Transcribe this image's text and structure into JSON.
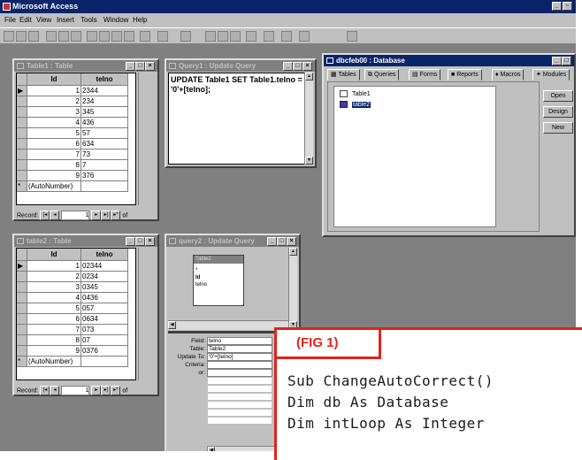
{
  "app": {
    "title": "Microsoft Access"
  },
  "menu": [
    "File",
    "Edit",
    "View",
    "Insert",
    "Tools",
    "Window",
    "Help"
  ],
  "table1": {
    "title": "Table1 : Table",
    "columns": [
      "Id",
      "telno"
    ],
    "rows": [
      [
        "1",
        "2344"
      ],
      [
        "2",
        "234"
      ],
      [
        "3",
        "345"
      ],
      [
        "4",
        "436"
      ],
      [
        "5",
        "57"
      ],
      [
        "6",
        "634"
      ],
      [
        "7",
        "73"
      ],
      [
        "8",
        "7"
      ],
      [
        "9",
        "376"
      ]
    ],
    "new_row": "(AutoNumber)",
    "record_label": "Record:",
    "record_value": "1",
    "of_label": "of"
  },
  "query1": {
    "title": "Query1 : Update Query",
    "sql": "UPDATE Table1 SET Table1.telno = '0'+[telno];"
  },
  "database": {
    "title": "dbcfeb00 : Database",
    "tabs": [
      "Tables",
      "Queries",
      "Forms",
      "Reports",
      "Macros",
      "Modules"
    ],
    "items": [
      "Table1",
      "table2"
    ],
    "buttons": [
      "Open",
      "Design",
      "New"
    ]
  },
  "table2": {
    "title": "table2 : Table",
    "columns": [
      "Id",
      "telno"
    ],
    "rows": [
      [
        "1",
        "02344"
      ],
      [
        "2",
        "0234"
      ],
      [
        "3",
        "0345"
      ],
      [
        "4",
        "0436"
      ],
      [
        "5",
        "057"
      ],
      [
        "6",
        "0634"
      ],
      [
        "7",
        "073"
      ],
      [
        "8",
        "07"
      ],
      [
        "9",
        "0376"
      ]
    ],
    "new_row": "(AutoNumber)",
    "record_label": "Record:",
    "record_value": "1",
    "of_label": "of"
  },
  "query2": {
    "title": "query2 : Update Query",
    "table_box": {
      "name": "Table2",
      "fields": [
        "*",
        "Id",
        "telno"
      ]
    },
    "grid": {
      "labels": [
        "Field:",
        "Table:",
        "Update To:",
        "Criteria:",
        "or:"
      ],
      "values": [
        "telno",
        "Table2",
        "'0'+[telno]",
        "",
        ""
      ]
    }
  },
  "figure": {
    "label": "(FIG 1)",
    "code": [
      "Sub ChangeAutoCorrect()",
      "Dim db As Database",
      "Dim intLoop As Integer"
    ]
  },
  "colors": {
    "accent": "#e2231a",
    "titlebar": "#0a246a",
    "workspace": "#808080"
  }
}
